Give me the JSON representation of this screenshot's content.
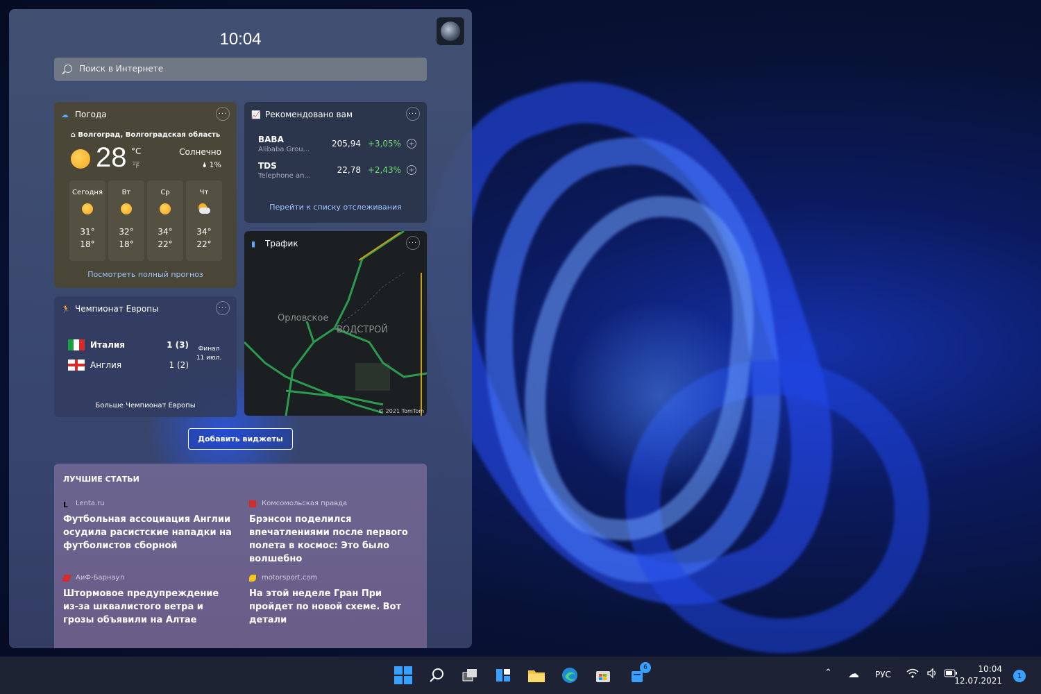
{
  "widgets": {
    "clock": "10:04",
    "search_placeholder": "Поиск в Интернете",
    "weather": {
      "title": "Погода",
      "location": "Волгоград, Волгоградская область",
      "temp": "28",
      "unit_c": "°C",
      "unit_f": "°F",
      "condition": "Солнечно",
      "precip": "1%",
      "days": [
        {
          "name": "Сегодня",
          "hi": "31°",
          "lo": "18°",
          "icon": "sun-icon"
        },
        {
          "name": "Вт",
          "hi": "32°",
          "lo": "18°",
          "icon": "sun-icon"
        },
        {
          "name": "Ср",
          "hi": "34°",
          "lo": "22°",
          "icon": "sun-icon"
        },
        {
          "name": "Чт",
          "hi": "34°",
          "lo": "22°",
          "icon": "partly-cloudy-icon"
        }
      ],
      "link": "Посмотреть полный прогноз"
    },
    "stocks": {
      "title": "Рекомендовано вам",
      "items": [
        {
          "symbol": "BABA",
          "name": "Alibaba Grou...",
          "price": "205,94",
          "change": "+3,05%"
        },
        {
          "symbol": "TDS",
          "name": "Telephone an...",
          "price": "22,78",
          "change": "+2,43%"
        }
      ],
      "link": "Перейти к списку отслеживания"
    },
    "traffic": {
      "title": "Трафик",
      "label1": "Орловское",
      "label2": "ВОДСТРОЙ",
      "copyright": "© 2021 TomTom"
    },
    "euro": {
      "title": "Чемпионат Европы",
      "teams": [
        {
          "name": "Италия",
          "score": "1 (3)"
        },
        {
          "name": "Англия",
          "score": "1 (2)"
        }
      ],
      "stage": "Финал",
      "date": "11 июл.",
      "link": "Больше Чемпионат Европы"
    },
    "add_widgets": "Добавить виджеты",
    "articles": {
      "heading": "ЛУЧШИЕ СТАТЬИ",
      "items": [
        {
          "source": "Lenta.ru",
          "title": "Футбольная ассоциация Англии осудила расистские нападки на футболистов сборной"
        },
        {
          "source": "Комсомольская правда",
          "title": "Брэнсон поделился впечатлениями после первого полета в космос: Это было волшебно"
        },
        {
          "source": "АиФ-Барнаул",
          "title": "Штормовое предупреждение из-за шквалистого ветра и грозы объявили на Алтае"
        },
        {
          "source": "motorsport.com",
          "title": "На этой неделе Гран При пройдет по новой схеме. Вот детали"
        }
      ]
    }
  },
  "taskbar": {
    "store_badge": "6",
    "lang": "РУС",
    "time": "10:04",
    "date": "12.07.2021",
    "notifications": "1"
  },
  "colors": {
    "accent": "#3aa0ff",
    "positive": "#6fdc6f",
    "link": "#9dc4ff"
  }
}
